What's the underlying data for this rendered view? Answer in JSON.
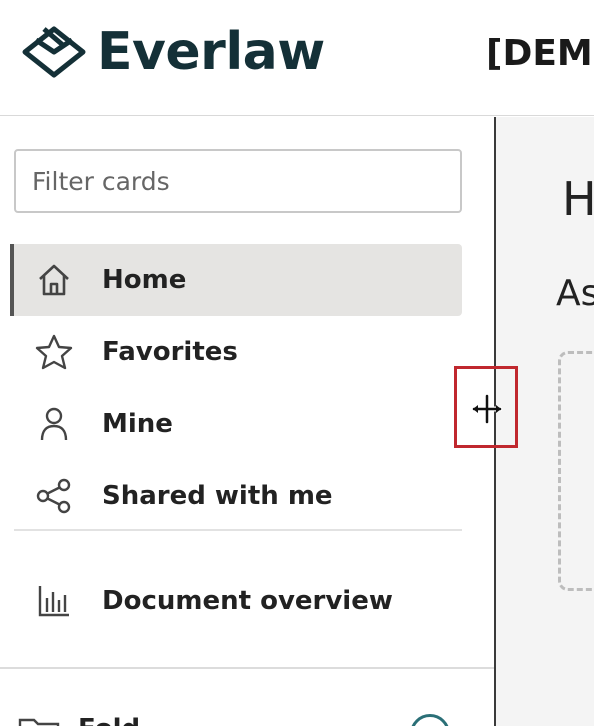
{
  "header": {
    "brand": "Everlaw",
    "project_title": "[DEMO"
  },
  "sidebar": {
    "filter_placeholder": "Filter cards",
    "items": [
      {
        "label": "Home",
        "icon": "home-icon",
        "active": true
      },
      {
        "label": "Favorites",
        "icon": "star-icon",
        "active": false
      },
      {
        "label": "Mine",
        "icon": "person-icon",
        "active": false
      },
      {
        "label": "Shared with me",
        "icon": "share-icon",
        "active": false
      }
    ],
    "secondary_items": [
      {
        "label": "Document overview",
        "icon": "bar-chart-icon"
      }
    ],
    "folders_label": "Fold"
  },
  "main": {
    "heading_partial": "H",
    "subheading_partial": "As"
  },
  "colors": {
    "brand": "#143037",
    "active_bg": "#e5e4e2",
    "highlight_box": "#c0282e",
    "accent": "#2a6f77"
  }
}
